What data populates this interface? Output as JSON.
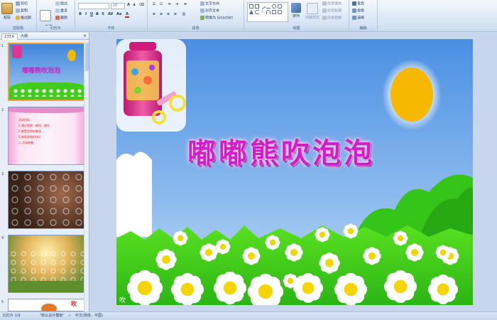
{
  "ribbon": {
    "clipboard": {
      "label": "剪贴板",
      "paste": "粘贴",
      "cut": "剪切",
      "copy": "复制",
      "format_painter": "格式刷"
    },
    "slides": {
      "label": "幻灯片",
      "new_slide": "新建\n幻灯片",
      "layout": "版式",
      "reset": "重设",
      "delete": "删除"
    },
    "font": {
      "label": "字体",
      "font_name": "",
      "font_size": "28"
    },
    "paragraph": {
      "label": "段落",
      "text_direction": "文字方向",
      "align_text": "对齐文本",
      "smartart": "转换为 SmartArt"
    },
    "drawing": {
      "label": "绘图",
      "arrange": "排列",
      "quick_styles": "快速样式",
      "shape_fill": "形状填充",
      "shape_outline": "形状轮廓",
      "shape_effects": "形状效果"
    },
    "editing": {
      "label": "编辑",
      "find": "查找",
      "replace": "替换",
      "select": "选择"
    }
  },
  "panel": {
    "tab_slides": "幻灯片",
    "tab_outline": "大纲",
    "slide_numbers": [
      "1",
      "2",
      "3",
      "4",
      "5"
    ],
    "thumb1_title": "嘟嘟熊吹泡泡",
    "thumb2_lines": [
      "活动目标",
      "1.通过观察、感知、操作",
      "2.感受泡泡的美丽",
      "3.体验游戏的快乐",
      "二.活动准备"
    ],
    "thumb5_text": "吹"
  },
  "slide": {
    "title": "嘟嘟熊吹泡泡",
    "footer_mark": "吹"
  },
  "status": {
    "slide_info": "幻灯片 1/9",
    "theme": "\"默认设计模板\"",
    "language": "中文(简体，中国)"
  },
  "colors": {
    "sky_top": "#4a8fe3",
    "sky_bottom": "#c2dcf3",
    "grass": "#3fcc1c",
    "sun": "#f6b800",
    "title": "#d21ec8"
  }
}
